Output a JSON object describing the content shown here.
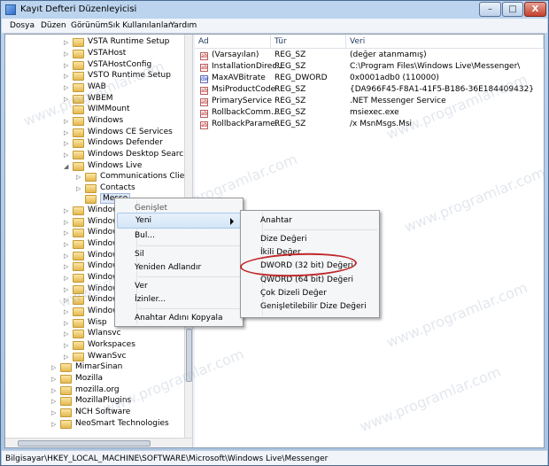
{
  "window": {
    "title": "Kayıt Defteri Düzenleyicisi",
    "controls": {
      "minimize": "–",
      "maximize": "□",
      "close": "X"
    }
  },
  "menubar": [
    "Dosya",
    "Düzen",
    "Görünüm",
    "Sık Kullanılanlar",
    "Yardım"
  ],
  "tree": {
    "items": [
      {
        "label": "VSTA Runtime Setup",
        "expander": "▷"
      },
      {
        "label": "VSTAHost",
        "expander": "▷"
      },
      {
        "label": "VSTAHostConfig",
        "expander": "▷"
      },
      {
        "label": "VSTO Runtime Setup",
        "expander": "▷"
      },
      {
        "label": "WAB",
        "expander": "▷"
      },
      {
        "label": "WBEM",
        "expander": "▷"
      },
      {
        "label": "WIMMount",
        "expander": ""
      },
      {
        "label": "Windows",
        "expander": "▷"
      },
      {
        "label": "Windows CE Services",
        "expander": "▷"
      },
      {
        "label": "Windows Defender",
        "expander": "▷"
      },
      {
        "label": "Windows Desktop Search",
        "expander": "▷"
      },
      {
        "label": "Windows Live",
        "expander": "◢"
      },
      {
        "label": "Communications Clients",
        "expander": "▷"
      },
      {
        "label": "Contacts",
        "expander": "▷"
      },
      {
        "label": "Messe",
        "expander": ""
      },
      {
        "label": "Windows",
        "expander": "▷"
      },
      {
        "label": "Windows",
        "expander": "▷"
      },
      {
        "label": "Windows",
        "expander": "▷"
      },
      {
        "label": "Windows",
        "expander": "▷"
      },
      {
        "label": "Windows",
        "expander": "▷"
      },
      {
        "label": "Windows",
        "expander": "▷"
      },
      {
        "label": "Windows",
        "expander": "▷"
      },
      {
        "label": "Windows",
        "expander": "▷"
      },
      {
        "label": "Windows",
        "expander": "▷"
      },
      {
        "label": "Windows",
        "expander": "▷"
      },
      {
        "label": "Wisp",
        "expander": "▷"
      },
      {
        "label": "Wlansvc",
        "expander": "▷"
      },
      {
        "label": "Workspaces",
        "expander": "▷"
      },
      {
        "label": "WwanSvc",
        "expander": "▷"
      },
      {
        "label": "MimarSinan",
        "expander": "▷"
      },
      {
        "label": "Mozilla",
        "expander": "▷"
      },
      {
        "label": "mozilla.org",
        "expander": "▷"
      },
      {
        "label": "MozillaPlugins",
        "expander": "▷"
      },
      {
        "label": "NCH Software",
        "expander": "▷"
      },
      {
        "label": "NeoSmart Technologies",
        "expander": "▷"
      }
    ]
  },
  "list": {
    "columns": [
      "Ad",
      "Tür",
      "Veri"
    ],
    "rows": [
      {
        "name": "(Varsayılan)",
        "type": "REG_SZ",
        "data": "(değer atanmamış)",
        "icon": "ab"
      },
      {
        "name": "InstallationDirec...",
        "type": "REG_SZ",
        "data": "C:\\Program Files\\Windows Live\\Messenger\\",
        "icon": "ab"
      },
      {
        "name": "MaxAVBitrate",
        "type": "REG_DWORD",
        "data": "0x0001adb0 (110000)",
        "icon": "dw"
      },
      {
        "name": "MsiProductCode",
        "type": "REG_SZ",
        "data": "{DA966F45-F8A1-41F5-B186-36E184409432}",
        "icon": "ab"
      },
      {
        "name": "PrimaryService",
        "type": "REG_SZ",
        "data": ".NET Messenger Service",
        "icon": "ab"
      },
      {
        "name": "RollbackComm...",
        "type": "REG_SZ",
        "data": "msiexec.exe",
        "icon": "ab"
      },
      {
        "name": "RollbackParame...",
        "type": "REG_SZ",
        "data": "/x MsnMsgs.Msi",
        "icon": "ab"
      }
    ]
  },
  "context_menu": {
    "header": "Genişlet",
    "items": [
      "Yeni",
      "Bul...",
      "Sil",
      "Yeniden Adlandır",
      "Ver",
      "İzinler...",
      "Anahtar Adını Kopyala"
    ]
  },
  "submenu": {
    "items": [
      "Anahtar",
      "Dize Değeri",
      "İkili Değer",
      "DWORD (32 bit) Değeri",
      "QWORD (64 bit) Değeri",
      "Çok Dizeli Değer",
      "Genişletilebilir Dize Değeri"
    ]
  },
  "statusbar": {
    "path": "Bilgisayar\\HKEY_LOCAL_MACHINE\\SOFTWARE\\Microsoft\\Windows Live\\Messenger"
  },
  "watermark": "www.programlar.com",
  "colors": {
    "highlight_circle": "#c0282a",
    "selection": "#dfe9f6"
  }
}
